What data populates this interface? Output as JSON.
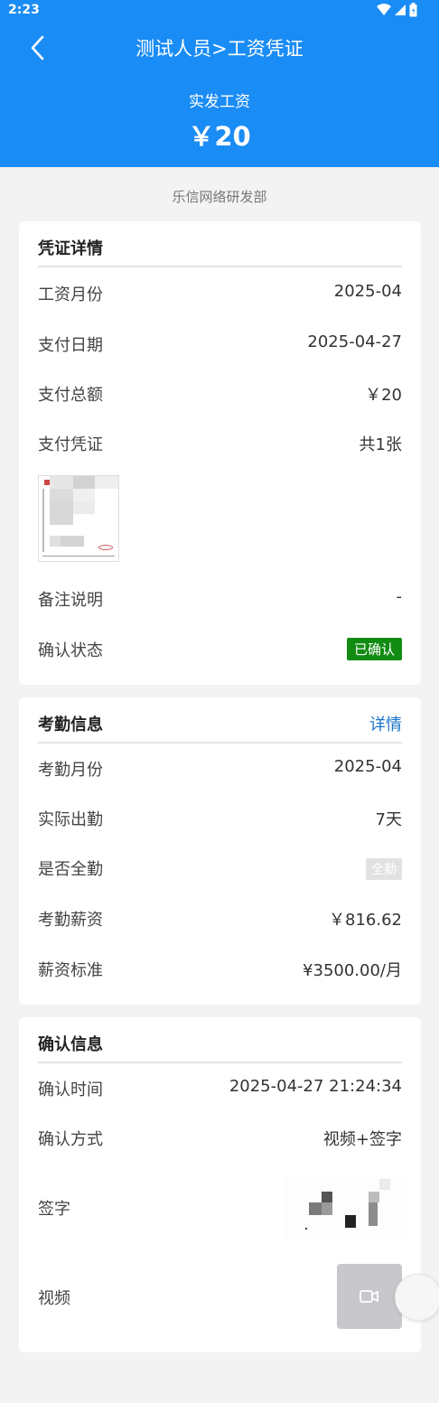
{
  "status_bar": {
    "time": "2:23"
  },
  "header": {
    "title": "测试人员>工资凭证",
    "amount_label": "实发工资",
    "amount_value": "￥20"
  },
  "company": "乐信网络研发部",
  "voucher_card": {
    "title": "凭证详情",
    "rows": [
      {
        "label": "工资月份",
        "value": "2025-04"
      },
      {
        "label": "支付日期",
        "value": "2025-04-27"
      },
      {
        "label": "支付总额",
        "value": "￥20"
      },
      {
        "label": "支付凭证",
        "value": "共1张"
      }
    ],
    "remark_label": "备注说明",
    "remark_value": "-",
    "status_label": "确认状态",
    "status_value": "已确认",
    "status_color": "#128b12"
  },
  "attendance_card": {
    "title": "考勤信息",
    "link": "详情",
    "rows": [
      {
        "label": "考勤月份",
        "value": "2025-04"
      },
      {
        "label": "实际出勤",
        "value": "7天"
      }
    ],
    "full_label": "是否全勤",
    "full_badge": "全勤",
    "salary_label": "考勤薪资",
    "salary_value": "￥816.62",
    "standard_label": "薪资标准",
    "standard_value": "¥3500.00/月"
  },
  "confirm_card": {
    "title": "确认信息",
    "rows": [
      {
        "label": "确认时间",
        "value": "2025-04-27 21:24:34"
      },
      {
        "label": "确认方式",
        "value": "视频+签字"
      }
    ],
    "signature_label": "签字",
    "video_label": "视频"
  },
  "icons": {
    "back": "chevron-left-icon",
    "wifi": "wifi-icon",
    "signal": "signal-icon",
    "battery": "battery-icon",
    "video": "video-camera-icon"
  },
  "colors": {
    "header_bg": "#1a8cf5",
    "link": "#1a73c8",
    "page_bg": "#f3f3f3"
  }
}
